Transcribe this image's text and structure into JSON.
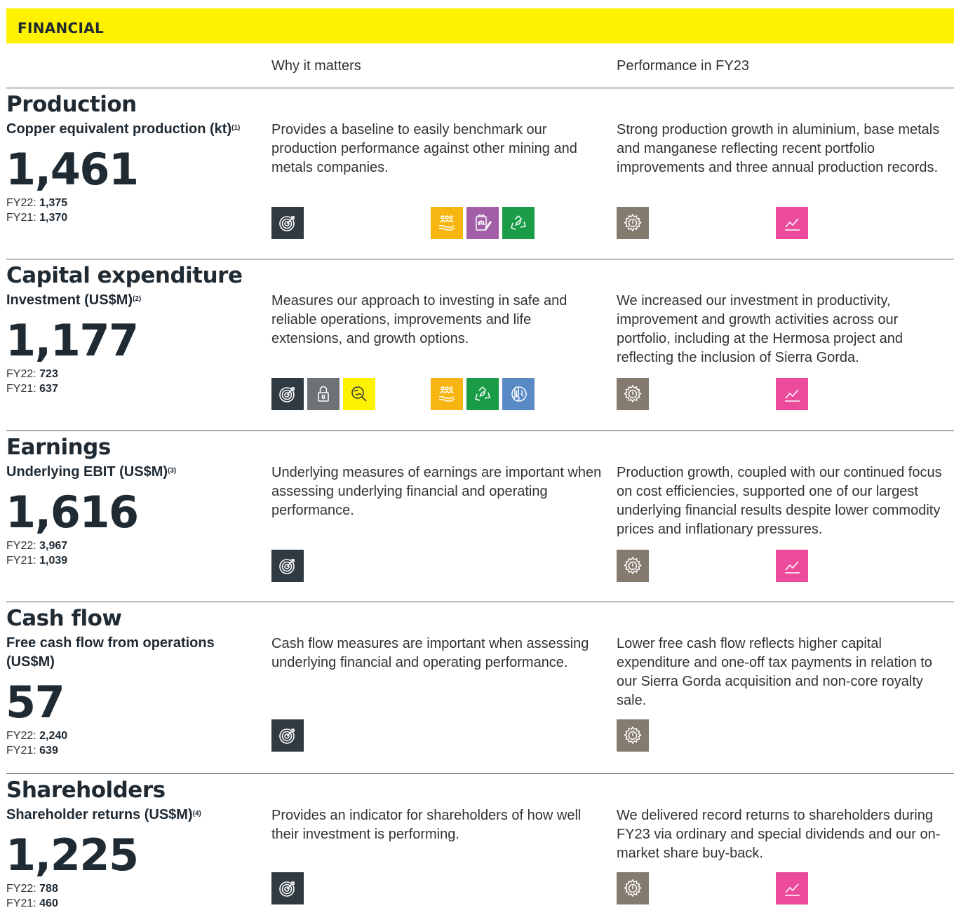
{
  "banner": {
    "label": "FINANCIAL"
  },
  "columns": {
    "why": "Why it matters",
    "performance": "Performance in FY23"
  },
  "colors": {
    "banner": "#fff200",
    "strategy": "#2f3a42",
    "security": "#6d7276",
    "exploration": "#fff200",
    "people": "#f6b511",
    "ethics": "#a35ea8",
    "environment": "#1a9c47",
    "climate": "#5a8ac6",
    "operations": "#857a6e",
    "growth": "#ec4b9c"
  },
  "sections": [
    {
      "title": "Production",
      "metric": "Copper equivalent production (kt)",
      "note": "(1)",
      "value": "1,461",
      "fy22_label": "FY22:",
      "fy22": "1,375",
      "fy21_label": "FY21:",
      "fy21": "1,370",
      "why": "Provides a baseline to easily benchmark our production performance against other mining and metals companies.",
      "performance": "Strong production growth in aluminium, base metals and manganese reflecting recent portfolio improvements and three annual production records.",
      "icons_left": [
        "target-icon"
      ],
      "icons_right": [
        "people-icon",
        "ethics-icon",
        "environment-icon"
      ],
      "perf_icons": [
        "operations-gear-icon",
        "growth-chart-icon"
      ]
    },
    {
      "title": "Capital expenditure",
      "metric": "Investment (US$M)",
      "note": "(2)",
      "value": "1,177",
      "fy22_label": "FY22:",
      "fy22": "723",
      "fy21_label": "FY21:",
      "fy21": "637",
      "why": "Measures our approach to investing in safe and reliable operations, improvements and life extensions, and growth options.",
      "performance": "We increased our investment in productivity, improvement and growth activities across our portfolio, including at the Hermosa project and reflecting the inclusion of Sierra Gorda.",
      "icons_left": [
        "target-icon",
        "lock-icon",
        "exploration-icon"
      ],
      "icons_right": [
        "people-icon",
        "environment-icon",
        "climate-icon"
      ],
      "perf_icons": [
        "operations-gear-icon",
        "growth-chart-icon"
      ]
    },
    {
      "title": "Earnings",
      "metric": "Underlying EBIT (US$M)",
      "note": "(3)",
      "value": "1,616",
      "fy22_label": "FY22:",
      "fy22": "3,967",
      "fy21_label": "FY21:",
      "fy21": "1,039",
      "why": "Underlying measures of earnings are important when assessing underlying financial and operating performance.",
      "performance": "Production growth, coupled with our continued focus on cost efficiencies, supported one of our largest underlying financial results despite lower commodity prices and inflationary pressures.",
      "icons_left": [
        "target-icon"
      ],
      "icons_right": [],
      "perf_icons": [
        "operations-gear-icon",
        "growth-chart-icon"
      ]
    },
    {
      "title": "Cash flow",
      "metric": "Free cash flow from operations (US$M)",
      "note": "",
      "value": "57",
      "fy22_label": "FY22:",
      "fy22": "2,240",
      "fy21_label": "FY21:",
      "fy21": "639",
      "why": "Cash flow measures are important when assessing underlying financial and operating performance.",
      "performance": "Lower free cash flow reflects higher capital expenditure and one-off tax payments in relation to our Sierra Gorda acquisition and non-core royalty sale.",
      "icons_left": [
        "target-icon"
      ],
      "icons_right": [],
      "perf_icons": [
        "operations-gear-icon"
      ]
    },
    {
      "title": "Shareholders",
      "metric": "Shareholder returns (US$M)",
      "note": "(4)",
      "value": "1,225",
      "fy22_label": "FY22:",
      "fy22": "788",
      "fy21_label": "FY21:",
      "fy21": "460",
      "why": "Provides an indicator for shareholders of how well their investment is performing.",
      "performance": "We delivered record returns to shareholders during FY23 via ordinary and special dividends and our on-market share buy-back.",
      "icons_left": [
        "target-icon"
      ],
      "icons_right": [],
      "perf_icons": [
        "operations-gear-icon",
        "growth-chart-icon"
      ]
    }
  ]
}
